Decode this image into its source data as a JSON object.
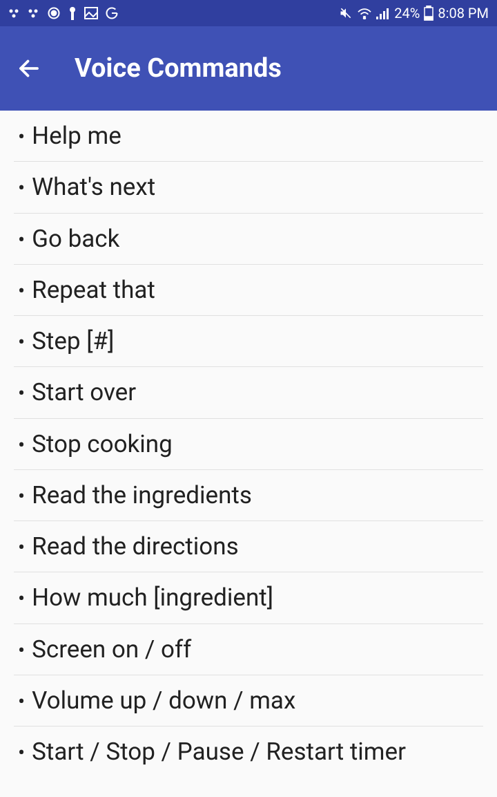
{
  "statusBar": {
    "batteryPercent": "24%",
    "time": "8:08 PM"
  },
  "appBar": {
    "title": "Voice Commands"
  },
  "commands": [
    "Help me",
    "What's next",
    "Go back",
    "Repeat that",
    "Step [#]",
    "Start over",
    "Stop cooking",
    "Read the ingredients",
    "Read the directions",
    "How much [ingredient]",
    "Screen on / off",
    "Volume up / down / max",
    "Start / Stop / Pause / Restart timer"
  ]
}
